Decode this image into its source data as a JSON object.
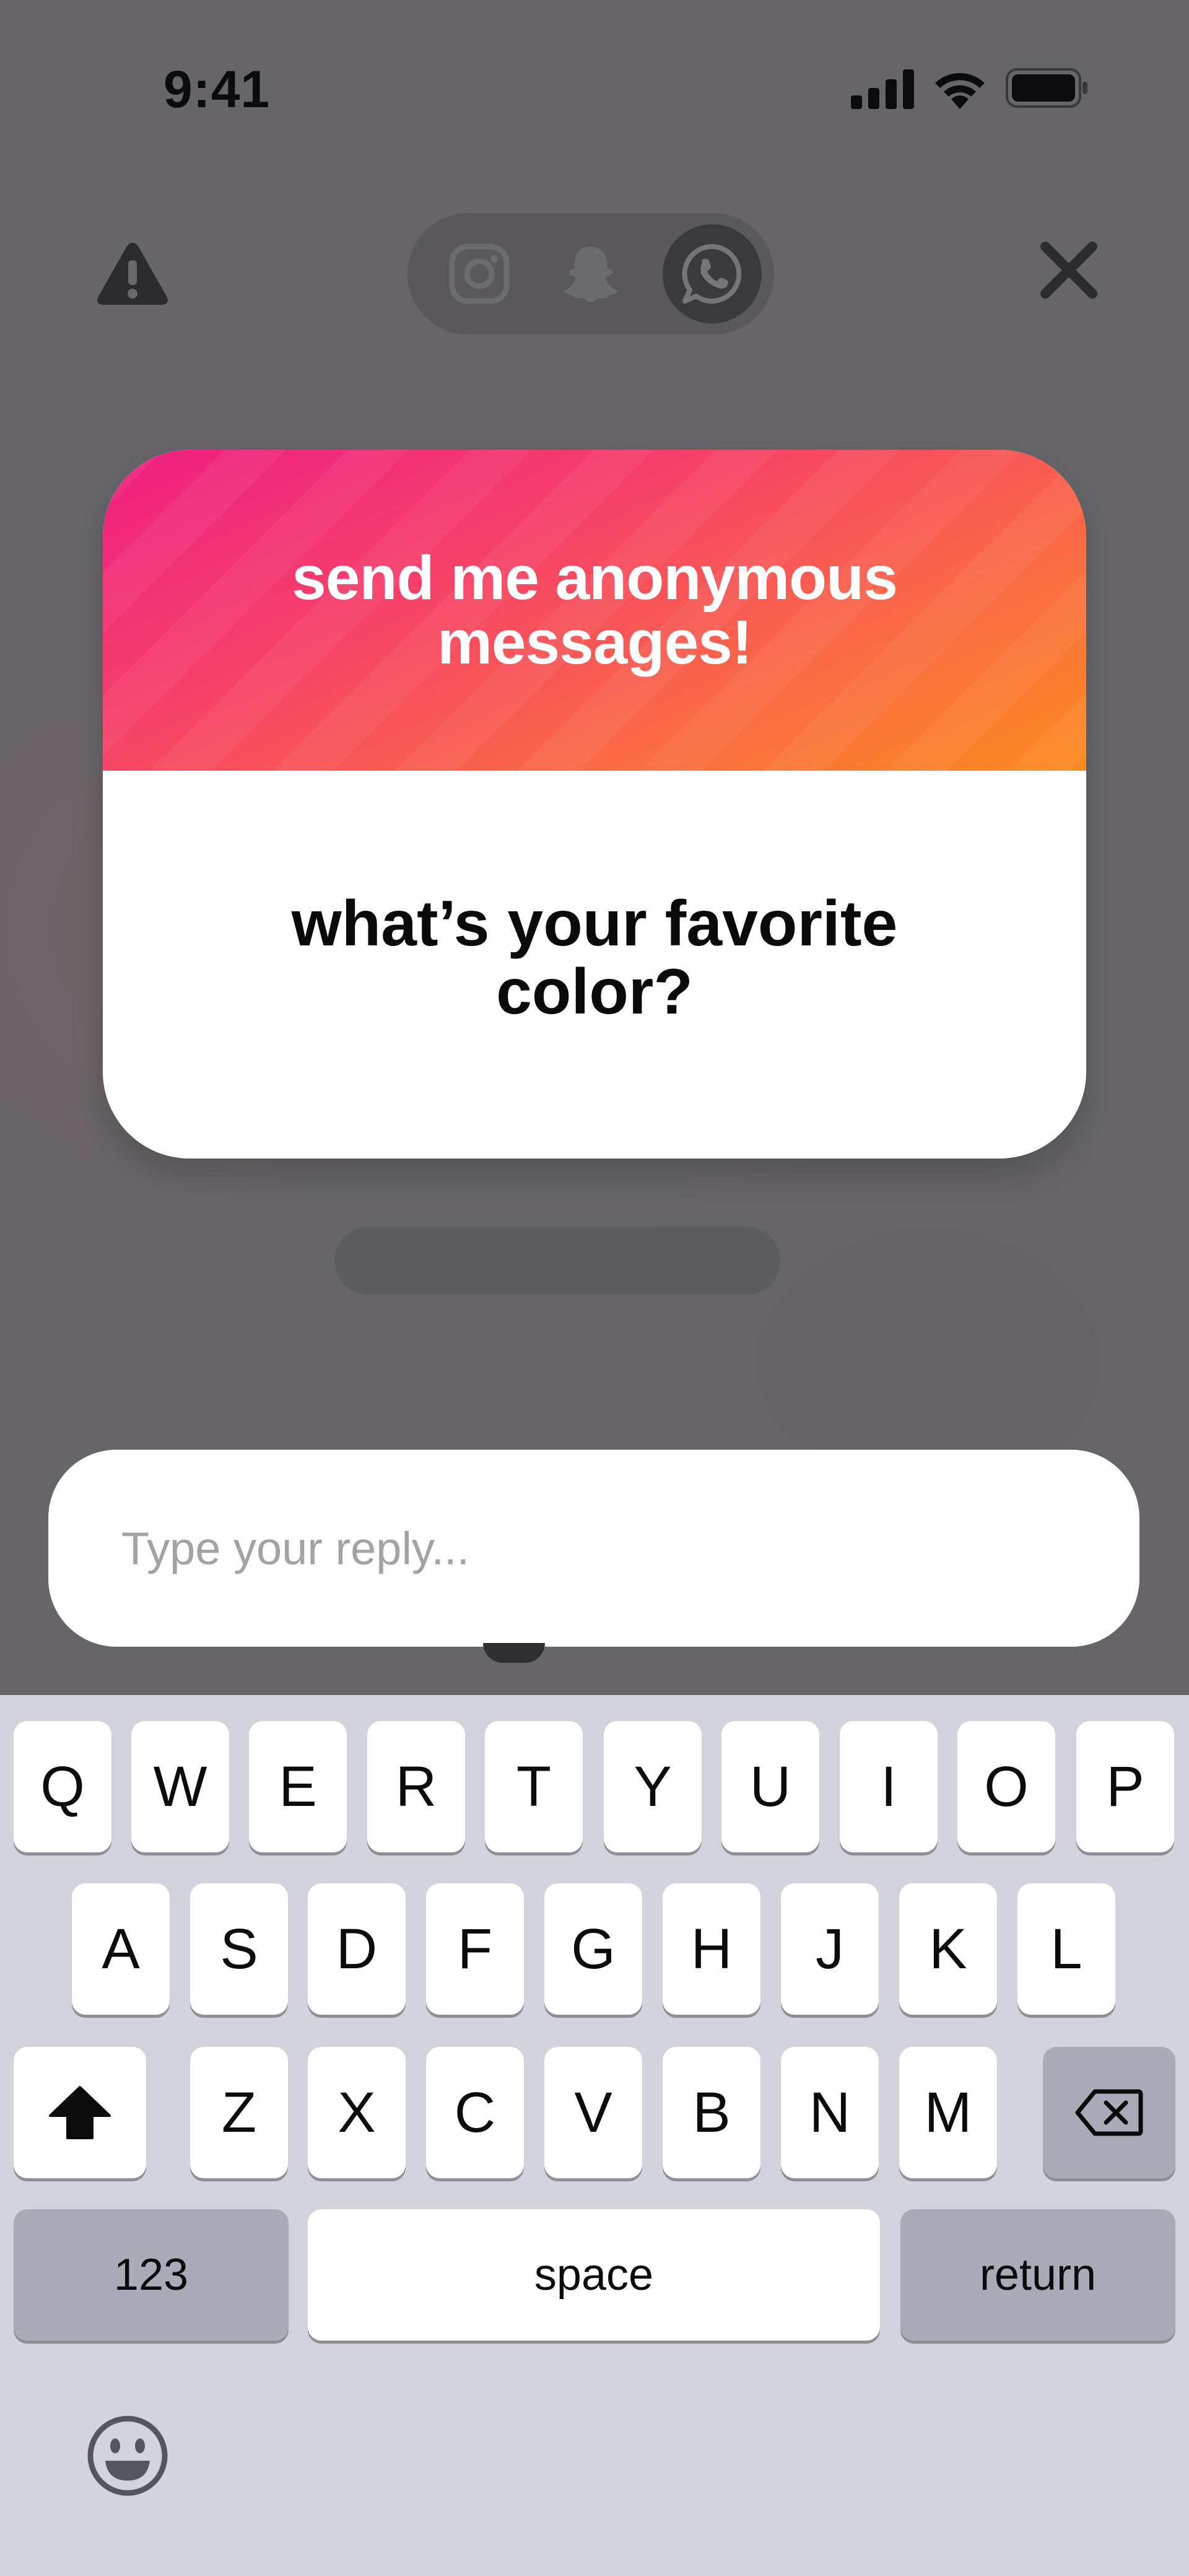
{
  "status_bar": {
    "time": "9:41",
    "icons": [
      "signal-icon",
      "wifi-icon",
      "battery-icon"
    ]
  },
  "top_bar": {
    "left_icon": "warning-icon",
    "right_icon": "close-icon",
    "share_targets": [
      "instagram-icon",
      "snapchat-icon",
      "whatsapp-icon"
    ],
    "selected_target": "whatsapp"
  },
  "card": {
    "header": "send me anonymous messages!",
    "question": "what’s your favorite color?",
    "gradient": [
      "#ee1f82",
      "#fd8b1f"
    ]
  },
  "reply": {
    "placeholder": "Type your reply...",
    "value": ""
  },
  "keyboard": {
    "row1": [
      "Q",
      "W",
      "E",
      "R",
      "T",
      "Y",
      "U",
      "I",
      "O",
      "P"
    ],
    "row2": [
      "A",
      "S",
      "D",
      "F",
      "G",
      "H",
      "J",
      "K",
      "L"
    ],
    "row3": [
      "Z",
      "X",
      "C",
      "V",
      "B",
      "N",
      "M"
    ],
    "shift_icon": "shift-icon",
    "delete_icon": "delete-icon",
    "numbers_label": "123",
    "space_label": "space",
    "return_label": "return",
    "emoji_icon": "emoji-icon"
  }
}
